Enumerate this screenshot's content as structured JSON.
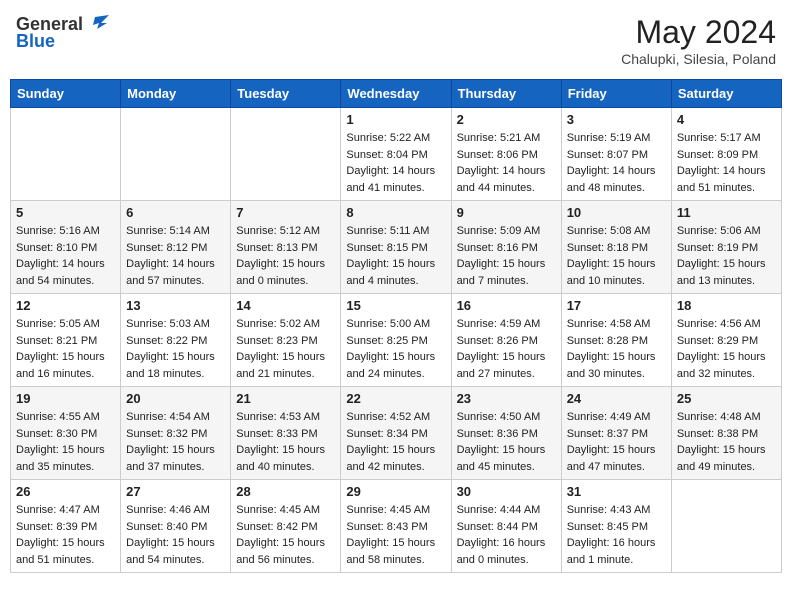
{
  "header": {
    "logo_general": "General",
    "logo_blue": "Blue",
    "month_title": "May 2024",
    "location": "Chalupki, Silesia, Poland"
  },
  "weekdays": [
    "Sunday",
    "Monday",
    "Tuesday",
    "Wednesday",
    "Thursday",
    "Friday",
    "Saturday"
  ],
  "weeks": [
    [
      {
        "day": "",
        "info": ""
      },
      {
        "day": "",
        "info": ""
      },
      {
        "day": "",
        "info": ""
      },
      {
        "day": "1",
        "info": "Sunrise: 5:22 AM\nSunset: 8:04 PM\nDaylight: 14 hours\nand 41 minutes."
      },
      {
        "day": "2",
        "info": "Sunrise: 5:21 AM\nSunset: 8:06 PM\nDaylight: 14 hours\nand 44 minutes."
      },
      {
        "day": "3",
        "info": "Sunrise: 5:19 AM\nSunset: 8:07 PM\nDaylight: 14 hours\nand 48 minutes."
      },
      {
        "day": "4",
        "info": "Sunrise: 5:17 AM\nSunset: 8:09 PM\nDaylight: 14 hours\nand 51 minutes."
      }
    ],
    [
      {
        "day": "5",
        "info": "Sunrise: 5:16 AM\nSunset: 8:10 PM\nDaylight: 14 hours\nand 54 minutes."
      },
      {
        "day": "6",
        "info": "Sunrise: 5:14 AM\nSunset: 8:12 PM\nDaylight: 14 hours\nand 57 minutes."
      },
      {
        "day": "7",
        "info": "Sunrise: 5:12 AM\nSunset: 8:13 PM\nDaylight: 15 hours\nand 0 minutes."
      },
      {
        "day": "8",
        "info": "Sunrise: 5:11 AM\nSunset: 8:15 PM\nDaylight: 15 hours\nand 4 minutes."
      },
      {
        "day": "9",
        "info": "Sunrise: 5:09 AM\nSunset: 8:16 PM\nDaylight: 15 hours\nand 7 minutes."
      },
      {
        "day": "10",
        "info": "Sunrise: 5:08 AM\nSunset: 8:18 PM\nDaylight: 15 hours\nand 10 minutes."
      },
      {
        "day": "11",
        "info": "Sunrise: 5:06 AM\nSunset: 8:19 PM\nDaylight: 15 hours\nand 13 minutes."
      }
    ],
    [
      {
        "day": "12",
        "info": "Sunrise: 5:05 AM\nSunset: 8:21 PM\nDaylight: 15 hours\nand 16 minutes."
      },
      {
        "day": "13",
        "info": "Sunrise: 5:03 AM\nSunset: 8:22 PM\nDaylight: 15 hours\nand 18 minutes."
      },
      {
        "day": "14",
        "info": "Sunrise: 5:02 AM\nSunset: 8:23 PM\nDaylight: 15 hours\nand 21 minutes."
      },
      {
        "day": "15",
        "info": "Sunrise: 5:00 AM\nSunset: 8:25 PM\nDaylight: 15 hours\nand 24 minutes."
      },
      {
        "day": "16",
        "info": "Sunrise: 4:59 AM\nSunset: 8:26 PM\nDaylight: 15 hours\nand 27 minutes."
      },
      {
        "day": "17",
        "info": "Sunrise: 4:58 AM\nSunset: 8:28 PM\nDaylight: 15 hours\nand 30 minutes."
      },
      {
        "day": "18",
        "info": "Sunrise: 4:56 AM\nSunset: 8:29 PM\nDaylight: 15 hours\nand 32 minutes."
      }
    ],
    [
      {
        "day": "19",
        "info": "Sunrise: 4:55 AM\nSunset: 8:30 PM\nDaylight: 15 hours\nand 35 minutes."
      },
      {
        "day": "20",
        "info": "Sunrise: 4:54 AM\nSunset: 8:32 PM\nDaylight: 15 hours\nand 37 minutes."
      },
      {
        "day": "21",
        "info": "Sunrise: 4:53 AM\nSunset: 8:33 PM\nDaylight: 15 hours\nand 40 minutes."
      },
      {
        "day": "22",
        "info": "Sunrise: 4:52 AM\nSunset: 8:34 PM\nDaylight: 15 hours\nand 42 minutes."
      },
      {
        "day": "23",
        "info": "Sunrise: 4:50 AM\nSunset: 8:36 PM\nDaylight: 15 hours\nand 45 minutes."
      },
      {
        "day": "24",
        "info": "Sunrise: 4:49 AM\nSunset: 8:37 PM\nDaylight: 15 hours\nand 47 minutes."
      },
      {
        "day": "25",
        "info": "Sunrise: 4:48 AM\nSunset: 8:38 PM\nDaylight: 15 hours\nand 49 minutes."
      }
    ],
    [
      {
        "day": "26",
        "info": "Sunrise: 4:47 AM\nSunset: 8:39 PM\nDaylight: 15 hours\nand 51 minutes."
      },
      {
        "day": "27",
        "info": "Sunrise: 4:46 AM\nSunset: 8:40 PM\nDaylight: 15 hours\nand 54 minutes."
      },
      {
        "day": "28",
        "info": "Sunrise: 4:45 AM\nSunset: 8:42 PM\nDaylight: 15 hours\nand 56 minutes."
      },
      {
        "day": "29",
        "info": "Sunrise: 4:45 AM\nSunset: 8:43 PM\nDaylight: 15 hours\nand 58 minutes."
      },
      {
        "day": "30",
        "info": "Sunrise: 4:44 AM\nSunset: 8:44 PM\nDaylight: 16 hours\nand 0 minutes."
      },
      {
        "day": "31",
        "info": "Sunrise: 4:43 AM\nSunset: 8:45 PM\nDaylight: 16 hours\nand 1 minute."
      },
      {
        "day": "",
        "info": ""
      }
    ]
  ]
}
